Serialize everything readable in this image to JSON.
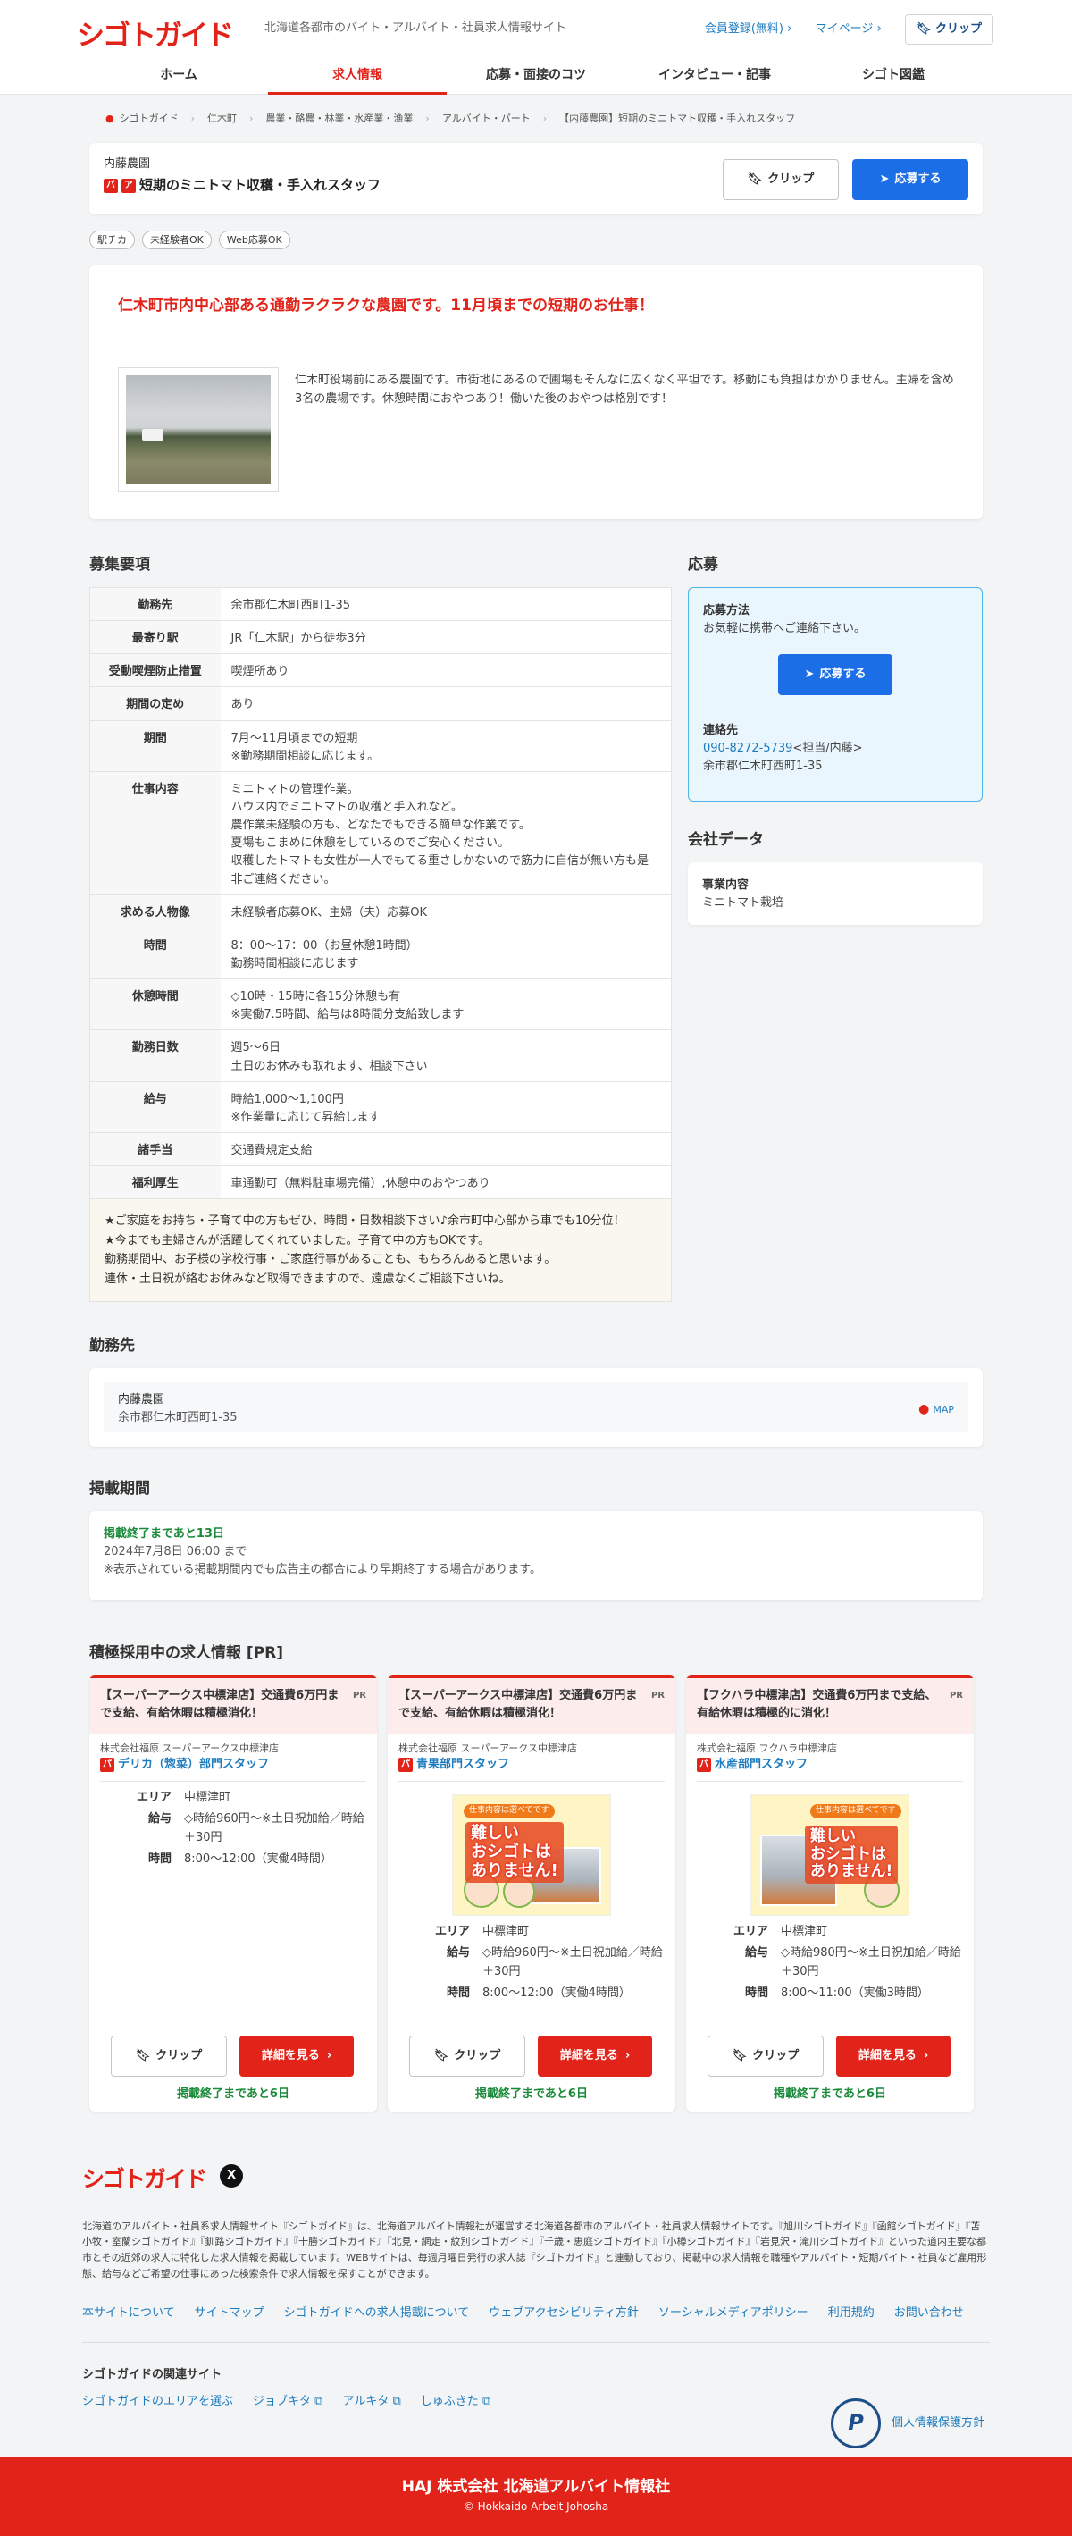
{
  "header": {
    "logo": "シゴトガイド",
    "tagline": "北海道各都市のバイト・アルバイト・社員求人情報サイト",
    "register": "会員登録(無料)",
    "mypage": "マイページ",
    "clip": "クリップ"
  },
  "nav": [
    "ホーム",
    "求人情報",
    "応募・面接のコツ",
    "インタビュー・記事",
    "シゴト図鑑"
  ],
  "breadcrumb": [
    "シゴトガイド",
    "仁木町",
    "農業・酪農・林業・水産業・漁業",
    "アルバイト・パート",
    "【内藤農園】短期のミニトマト収穫・手入れスタッフ"
  ],
  "job": {
    "company": "内藤農園",
    "badge_ba": "バ",
    "badge_a": "ア",
    "title": "短期のミニトマト収穫・手入れスタッフ",
    "clip_label": "クリップ",
    "apply_label": "応募する"
  },
  "tags": [
    "駅チカ",
    "未経験者OK",
    "Web応募OK"
  ],
  "intro": {
    "title": "仁木町市内中心部ある通勤ラクラクな農園です。11月頃までの短期のお仕事！",
    "text": "仁木町役場前にある農園です。市街地にあるので圃場もそんなに広くなく平坦です。移動にも負担はかかりません。主婦を含め3名の農場です。休憩時間におやつあり！働いた後のおやつは格別です！"
  },
  "requirements": {
    "title": "募集要項",
    "rows": [
      {
        "label": "勤務先",
        "value": "余市郡仁木町西町1-35"
      },
      {
        "label": "最寄り駅",
        "value": "JR「仁木駅」から徒歩3分"
      },
      {
        "label": "受動喫煙防止措置",
        "value": "喫煙所あり"
      },
      {
        "label": "期間の定め",
        "value": "あり"
      },
      {
        "label": "期間",
        "value": "7月〜11月頃までの短期\n※勤務期間相談に応じます。"
      },
      {
        "label": "仕事内容",
        "value": "ミニトマトの管理作業。\nハウス内でミニトマトの収穫と手入れなど。\n農作業未経験の方も、どなたでもできる簡単な作業です。\n夏場もこまめに休憩をしているのでご安心ください。\n収穫したトマトも女性が一人でもてる重さしかないので筋力に自信が無い方も是非ご連絡ください。"
      },
      {
        "label": "求める人物像",
        "value": "未経験者応募OK、主婦（夫）応募OK"
      },
      {
        "label": "時間",
        "value": "8：00〜17：00（お昼休憩1時間）\n勤務時間相談に応じます"
      },
      {
        "label": "休憩時間",
        "value": "◇10時・15時に各15分休憩も有\n※実働7.5時間、給与は8時間分支給致します"
      },
      {
        "label": "勤務日数",
        "value": "週5〜6日\n土日のお休みも取れます、相談下さい"
      },
      {
        "label": "給与",
        "value": "時給1,000〜1,100円\n※作業量に応じて昇給します"
      },
      {
        "label": "諸手当",
        "value": "交通費規定支給"
      },
      {
        "label": "福利厚生",
        "value": "車通勤可（無料駐車場完備）,休憩中のおやつあり"
      }
    ],
    "note": "★ご家庭をお持ち・子育て中の方もぜひ、時間・日数相談下さい♪余市町中心部から車でも10分位！\n★今までも主婦さんが活躍してくれていました。子育て中の方もOKです。\n勤務期間中、お子様の学校行事・ご家庭行事があることも、もちろんあると思います。\n連休・土日祝が絡むお休みなど取得できますので、遠慮なくご相談下さいね。"
  },
  "apply": {
    "title": "応募",
    "method_label": "応募方法",
    "method_text": "お気軽に携帯へご連絡下さい。",
    "button": "応募する",
    "contact_label": "連絡先",
    "phone": "090-8272-5739",
    "contact_person": "<担当/内藤>",
    "address": "余市郡仁木町西町1-35"
  },
  "company_data": {
    "title": "会社データ",
    "label": "事業内容",
    "value": "ミニトマト栽培"
  },
  "location": {
    "title": "勤務先",
    "name": "内藤農園",
    "address": "余市郡仁木町西町1-35",
    "map": "MAP"
  },
  "period": {
    "title": "掲載期間",
    "remaining": "掲載終了まであと13日",
    "date": "2024年7月8日 06:00 まで",
    "note": "※表示されている掲載期間内でも広告主の都合により早期終了する場合があります。"
  },
  "pr": {
    "title": "積極採用中の求人情報 [PR]",
    "tag": "PR",
    "clip_label": "クリップ",
    "detail_label": "詳細を見る",
    "area_key": "エリア",
    "pay_key": "給与",
    "time_key": "時間",
    "illustration_banner": "仕事内容は選べてです",
    "illustration_text": "難しい\nおシゴトは\nありません!",
    "cards": [
      {
        "headline": "【スーパーアークス中標津店】交通費6万円まで支給、有給休暇は積極消化！",
        "company": "株式会社福原 スーパーアークス中標津店",
        "job_badge": "パ",
        "job": "デリカ（惣菜）部門スタッフ",
        "area": "中標津町",
        "pay": "◇時給960円〜※土日祝加給／時給＋30円",
        "time": "8:00〜12:00（実働4時間）",
        "remaining": "掲載終了まであと6日"
      },
      {
        "headline": "【スーパーアークス中標津店】交通費6万円まで支給、有給休暇は積極消化！",
        "company": "株式会社福原 スーパーアークス中標津店",
        "job_badge": "パ",
        "job": "青果部門スタッフ",
        "area": "中標津町",
        "pay": "◇時給960円〜※土日祝加給／時給＋30円",
        "time": "8:00〜12:00（実働4時間）",
        "remaining": "掲載終了まであと6日"
      },
      {
        "headline": "【フクハラ中標津店】交通費6万円まで支給、有給休暇は積極的に消化！",
        "company": "株式会社福原 フクハラ中標津店",
        "job_badge": "パ",
        "job": "水産部門スタッフ",
        "area": "中標津町",
        "pay": "◇時給980円〜※土日祝加給／時給＋30円",
        "time": "8:00〜11:00（実働3時間）",
        "remaining": "掲載終了まであと6日"
      }
    ]
  },
  "footer": {
    "logo": "シゴトガイド",
    "x_icon": "X",
    "description": "北海道のアルバイト・社員系求人情報サイト『シゴトガイド』は、北海道アルバイト情報社が運営する北海道各都市のアルバイト・社員求人情報サイトです。『旭川シゴトガイド』『函館シゴトガイド』『苫小牧・室蘭シゴトガイド』『釧路シゴトガイド』『十勝シゴトガイド』『北見・網走・紋別シゴトガイド』『千歳・恵庭シゴトガイド』『小樽シゴトガイド』『岩見沢・滝川シゴトガイド』といった道内主要な都市とその近郊の求人に特化した求人情報を掲載しています。WEBサイトは、毎週月曜日発行の求人誌『シゴトガイド』と連動しており、掲載中の求人情報を職種やアルバイト・短期バイト・社員など雇用形態、給与などご希望の仕事にあった検索条件で求人情報を探すことができます。",
    "links": [
      "本サイトについて",
      "サイトマップ",
      "シゴトガイドへの求人掲載について",
      "ウェブアクセシビリティ方針",
      "ソーシャルメディアポリシー",
      "利用規約",
      "お問い合わせ"
    ],
    "related_title": "シゴトガイドの関連サイト",
    "related": [
      "シゴトガイドのエリアを選ぶ",
      "ジョブキタ",
      "アルキタ",
      "しゅふきた"
    ],
    "privacy": "個人情報保護方針",
    "privacy_mark": "P"
  },
  "bottom_bar": {
    "title": "HAJ 株式会社 北海道アルバイト情報社",
    "copyright": "© Hokkaido Arbeit Johosha"
  },
  "colors": {
    "brand_red": "#e2231a",
    "link_blue": "#1c7bbf",
    "apply_blue": "#1b6ee5",
    "green": "#1a8a3a"
  }
}
